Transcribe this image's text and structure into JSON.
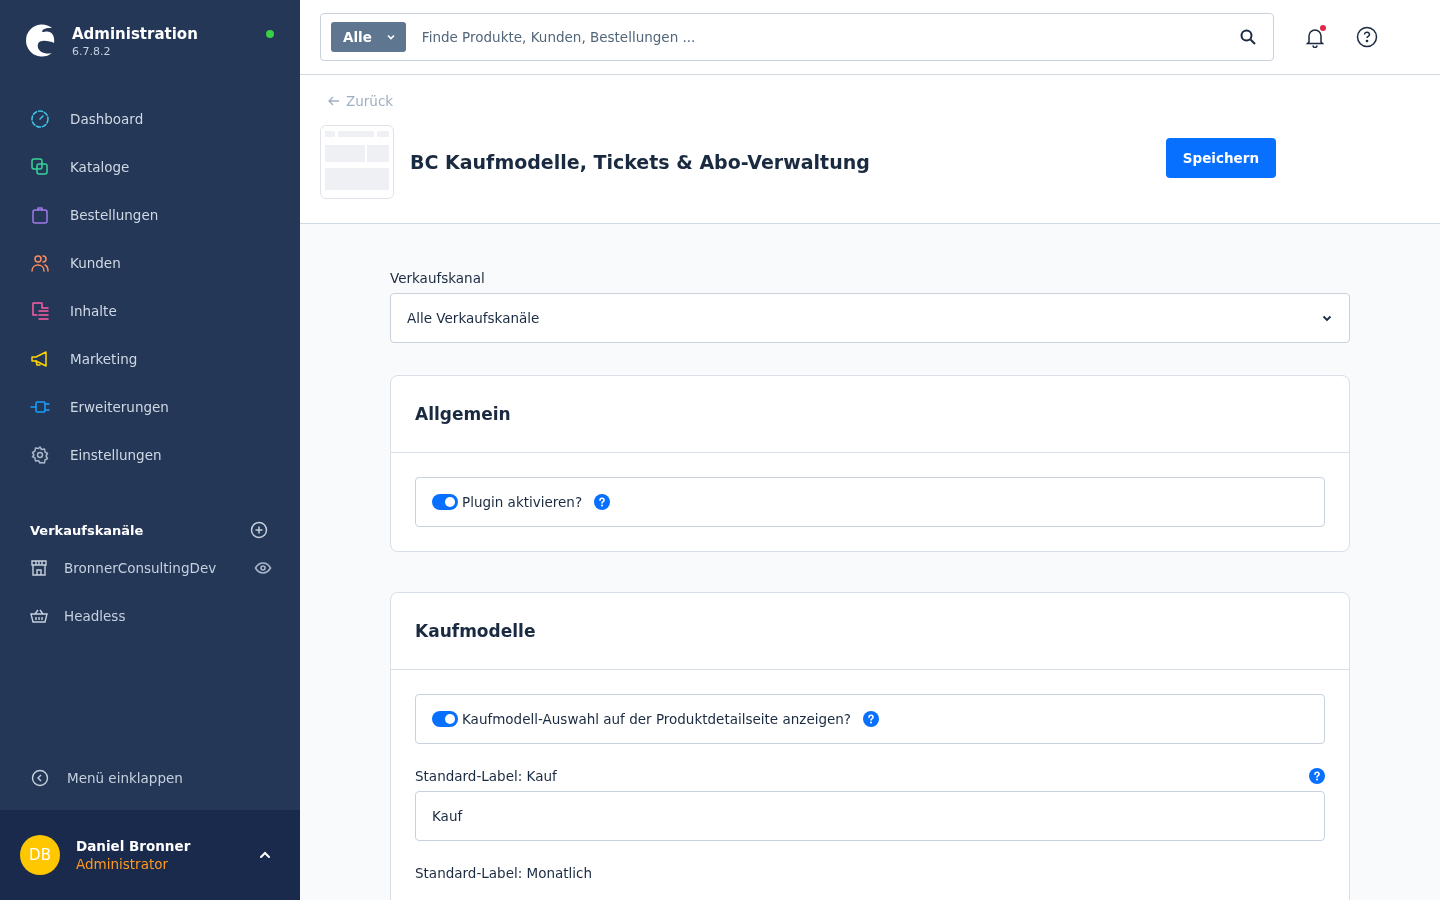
{
  "sidebar": {
    "title": "Administration",
    "version": "6.7.8.2",
    "online": true,
    "items": [
      {
        "label": "Dashboard"
      },
      {
        "label": "Kataloge"
      },
      {
        "label": "Bestellungen"
      },
      {
        "label": "Kunden"
      },
      {
        "label": "Inhalte"
      },
      {
        "label": "Marketing"
      },
      {
        "label": "Erweiterungen"
      },
      {
        "label": "Einstellungen"
      }
    ],
    "sales_channels": {
      "title": "Verkaufskanäle",
      "items": [
        {
          "label": "BronnerConsultingDev",
          "kind": "storefront"
        },
        {
          "label": "Headless",
          "kind": "headless"
        }
      ]
    },
    "collapse": "Menü einklappen",
    "user": {
      "initials": "DB",
      "name": "Daniel Bronner",
      "role": "Administrator"
    }
  },
  "search": {
    "scope": "Alle",
    "placeholder": "Finde Produkte, Kunden, Bestellungen ..."
  },
  "notifications": {
    "unread": true
  },
  "back": "Zurück",
  "page_title": "BC Kaufmodelle, Tickets & Abo-Verwaltung",
  "save_button": "Speichern",
  "sales_channel_select": {
    "label": "Verkaufskanal",
    "value": "Alle Verkaufskanäle"
  },
  "cards": [
    {
      "title": "Allgemein",
      "fields": [
        {
          "kind": "toggle",
          "label": "Plugin aktivieren?",
          "on": true,
          "help": true
        }
      ]
    },
    {
      "title": "Kaufmodelle",
      "fields": [
        {
          "kind": "toggle",
          "label": "Kaufmodell-Auswahl auf der Produktdetailseite anzeigen?",
          "on": true,
          "help": true
        },
        {
          "kind": "text",
          "label": "Standard-Label: Kauf",
          "value": "Kauf",
          "help": true
        },
        {
          "kind": "label",
          "label": "Standard-Label: Monatlich"
        }
      ]
    }
  ]
}
